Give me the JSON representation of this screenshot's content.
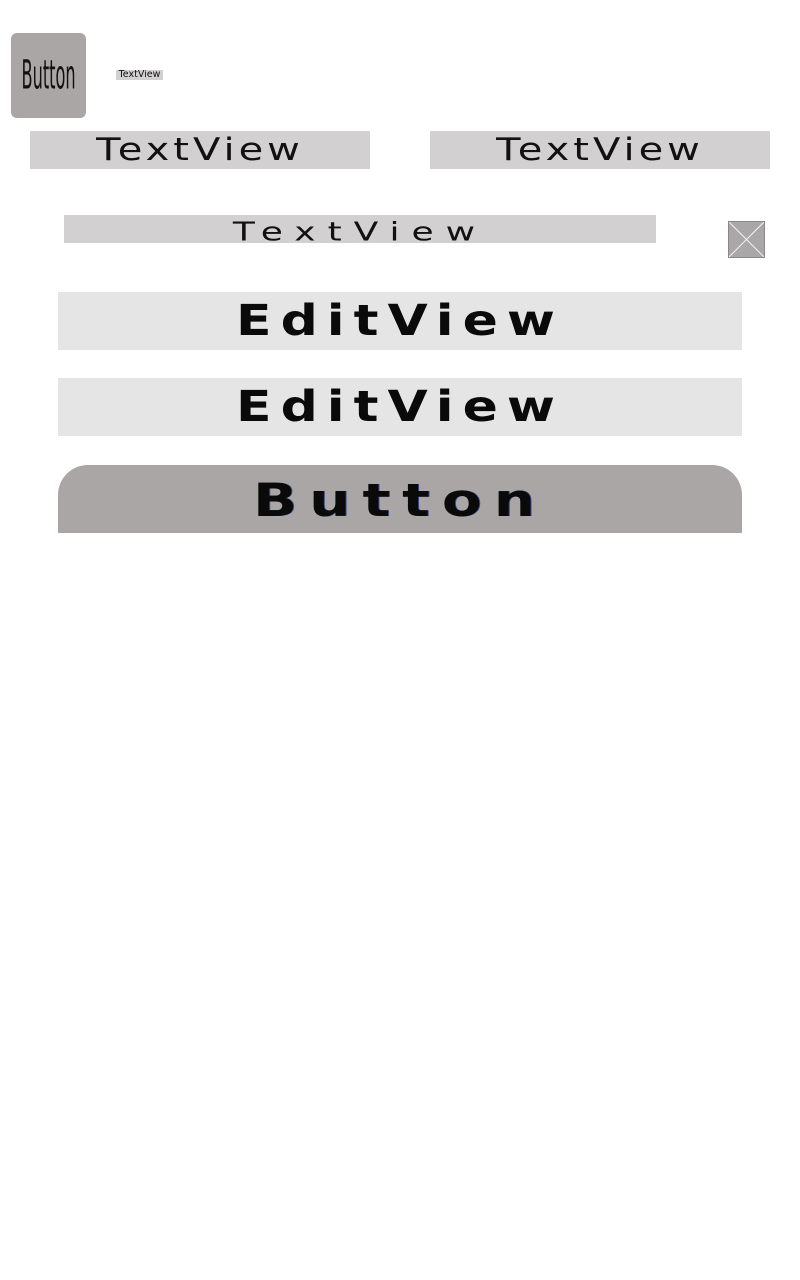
{
  "screen": {
    "small_button": {
      "label": "Button"
    },
    "tiny_textview": {
      "text": "TextView"
    },
    "textview_left": {
      "text": "TextView"
    },
    "textview_right": {
      "text": "TextView"
    },
    "textview_wide": {
      "text": "TextView"
    },
    "image_placeholder": {
      "icon": "broken-image-x-icon"
    },
    "edit_field_1": {
      "value": "EditView"
    },
    "edit_field_2": {
      "value": "EditView"
    },
    "main_button": {
      "label": "Button"
    }
  },
  "colors": {
    "button_bg": "#aaa6a6",
    "textview_bg": "#d2d0d0",
    "edit_bg": "#e6e5e5",
    "page_bg": "#ffffff"
  }
}
